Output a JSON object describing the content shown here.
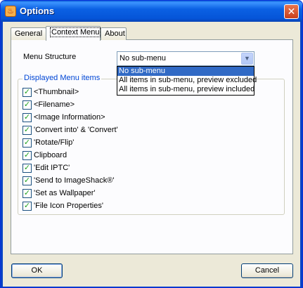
{
  "window": {
    "title": "Options",
    "icon": "app-icon",
    "close_glyph": "✕"
  },
  "tabs": [
    {
      "label": "General"
    },
    {
      "label": "Context Menu",
      "active": true
    },
    {
      "label": "About"
    }
  ],
  "menu_structure": {
    "label": "Menu Structure",
    "selected": "No sub-menu",
    "options": [
      "No sub-menu",
      "All items in sub-menu, preview excluded",
      "All items in sub-menu, preview included"
    ]
  },
  "displayed_items": {
    "title": "Displayed Menu items",
    "items": [
      {
        "label": "<Thumbnail>",
        "checked": true
      },
      {
        "label": "<Filename>",
        "checked": true
      },
      {
        "label": "<Image Information>",
        "checked": true
      },
      {
        "label": "'Convert into' & 'Convert'",
        "checked": true
      },
      {
        "label": "'Rotate/Flip'",
        "checked": true
      },
      {
        "label": "Clipboard",
        "checked": true
      },
      {
        "label": "'Edit IPTC'",
        "checked": true
      },
      {
        "label": "'Send to ImageShack®'",
        "checked": true
      },
      {
        "label": "'Set as Wallpaper'",
        "checked": true
      },
      {
        "label": "'File Icon Properties'",
        "checked": true
      }
    ]
  },
  "buttons": {
    "ok": "OK",
    "cancel": "Cancel"
  },
  "colors": {
    "accent": "#316ac5",
    "title_bar": "#0554d8",
    "group_title": "#0046d5",
    "check": "#21a121"
  }
}
